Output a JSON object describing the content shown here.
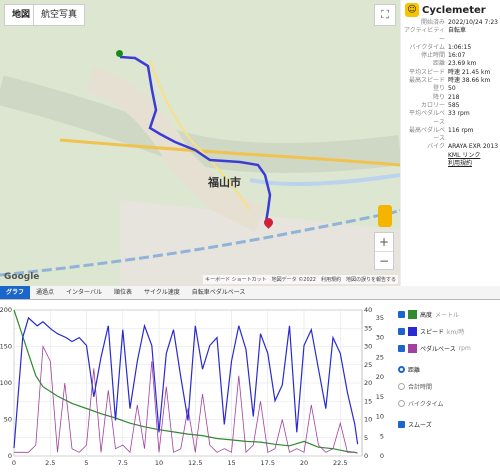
{
  "map": {
    "btn_map": "地図",
    "btn_aerial": "航空写真",
    "city_label": "福山市",
    "google": "Google",
    "attribution": "キーボード ショートカット　地図データ ©2022　利用規約　地図の誤りを報告する"
  },
  "app": {
    "name": "Cyclemeter"
  },
  "stats": [
    {
      "k": "開始済み",
      "v": "2022/10/24 7:23"
    },
    {
      "k": "アクティビティー",
      "v": "自転車"
    },
    {
      "k": "バイクタイム",
      "v": "1:06:15"
    },
    {
      "k": "停止時間",
      "v": "16:07"
    },
    {
      "k": "距離",
      "v": "23.69 km"
    },
    {
      "k": "平均スピード",
      "v": "時速 21.45 km"
    },
    {
      "k": "最高スピード",
      "v": "時速 38.66 km"
    },
    {
      "k": "登り",
      "v": "50"
    },
    {
      "k": "降り",
      "v": "218"
    },
    {
      "k": "カロリー",
      "v": "585"
    },
    {
      "k": "平均ペダルベース",
      "v": "33 rpm"
    },
    {
      "k": "最高ペダルベース",
      "v": "116 rpm"
    },
    {
      "k": "バイク",
      "v": "ARAYA EXR 2013"
    }
  ],
  "links": {
    "kml": "KML リンク",
    "terms": "利用規約"
  },
  "tabs": [
    "グラフ",
    "通過点",
    "インターバル",
    "順位表",
    "サイクル速度",
    "自転車ペダルベース"
  ],
  "legend": {
    "altitude": "高度",
    "altitude_unit": "メートル",
    "speed": "スピード",
    "speed_unit": "km/時",
    "cadence": "ペダルベース",
    "cadence_unit": "rpm"
  },
  "xaxis_options": [
    "距離",
    "合計時間",
    "バイクタイム"
  ],
  "smooth_label": "スムーズ",
  "colors": {
    "altitude": "#2e8b2e",
    "speed": "#2a2ad0",
    "cadence": "#a040a0",
    "accent": "#1a66cc"
  },
  "chart_data": {
    "type": "line",
    "x_ticks": [
      0,
      2.5,
      5,
      7.5,
      10,
      12.5,
      15,
      17.5,
      20,
      22.5
    ],
    "xlim": [
      0,
      24
    ],
    "y_left_ticks": [
      0,
      50,
      100,
      150,
      200
    ],
    "y_left_lim": [
      0,
      200
    ],
    "y_mid_ticks": [
      0,
      5,
      10,
      15,
      20,
      25,
      30,
      35,
      40
    ],
    "y_mid_lim": [
      0,
      40
    ],
    "y_right_ticks": [
      0,
      5,
      10,
      15,
      20,
      25,
      30,
      35
    ],
    "y_right_lim": [
      0,
      37
    ],
    "series": [
      {
        "name": "高度",
        "axis": "left",
        "x": [
          0,
          0.5,
          1,
          1.5,
          2,
          3,
          4,
          5,
          6,
          7,
          8,
          9,
          10,
          11,
          12,
          13,
          14,
          15,
          16,
          17,
          18,
          19,
          20,
          21,
          22,
          22.5,
          23,
          23.5,
          23.7
        ],
        "values": [
          200,
          170,
          140,
          110,
          95,
          82,
          72,
          65,
          58,
          52,
          45,
          40,
          36,
          33,
          30,
          28,
          24,
          22,
          20,
          19,
          16,
          14,
          20,
          12,
          10,
          8,
          6,
          5,
          4
        ]
      },
      {
        "name": "スピード",
        "axis": "right",
        "x": [
          0,
          0.6,
          1,
          1.6,
          2,
          2.6,
          3,
          3.6,
          4,
          4.5,
          5,
          5.5,
          6,
          6.5,
          7,
          7.5,
          8,
          8.5,
          9,
          9.5,
          10,
          10.5,
          11,
          11.5,
          12,
          12.5,
          13,
          13.5,
          14,
          14.5,
          15,
          15.5,
          16,
          16.5,
          17,
          17.5,
          18,
          18.5,
          19,
          19.5,
          20,
          20.5,
          21,
          21.5,
          22,
          22.5,
          23,
          23.5,
          23.7
        ],
        "values": [
          2,
          30,
          35,
          33,
          34,
          32,
          31,
          30,
          29,
          30,
          28,
          15,
          25,
          33,
          9,
          32,
          12,
          24,
          33,
          28,
          6,
          26,
          32,
          20,
          9,
          33,
          22,
          28,
          30,
          8,
          24,
          33,
          27,
          10,
          31,
          26,
          14,
          18,
          33,
          6,
          28,
          32,
          22,
          12,
          30,
          26,
          16,
          8,
          3
        ]
      },
      {
        "name": "ペダルベース",
        "axis": "mid",
        "x": [
          0,
          1,
          1.5,
          2,
          2.5,
          3,
          3.5,
          4,
          4.5,
          5,
          5.5,
          6,
          6.5,
          7,
          7.5,
          8,
          8.5,
          9,
          9.5,
          10,
          10.5,
          11,
          11.5,
          12,
          12.5,
          13,
          13.5,
          14,
          14.5,
          15,
          15.5,
          16,
          16.5,
          17,
          17.5,
          18,
          18.5,
          19,
          19.5,
          20,
          20.5,
          21,
          21.5,
          22,
          22.5,
          23,
          23.5
        ],
        "values": [
          1,
          1,
          3,
          30,
          26,
          1,
          20,
          2,
          1,
          3,
          24,
          1,
          18,
          2,
          3,
          1,
          14,
          2,
          26,
          1,
          19,
          1,
          2,
          13,
          1,
          17,
          3,
          1,
          2,
          1,
          22,
          1,
          3,
          15,
          1,
          2,
          10,
          1,
          2,
          1,
          14,
          3,
          1,
          2,
          9,
          1,
          1
        ]
      }
    ]
  }
}
